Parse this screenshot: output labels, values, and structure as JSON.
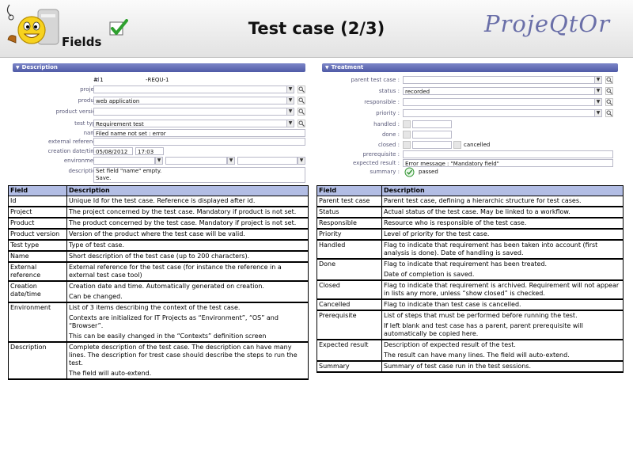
{
  "header": {
    "fields_label": "Fields",
    "title": "Test case (2/3)",
    "brand": "ProjeQtOr"
  },
  "description_panel": {
    "title": "Description",
    "fields": {
      "id": {
        "label": "id :",
        "value": "#  1",
        "ref": "-REQU-1"
      },
      "project": {
        "label": "project :",
        "value": ""
      },
      "product": {
        "label": "product :",
        "value": "web application"
      },
      "product_version": {
        "label": "product version :",
        "value": ""
      },
      "test_type": {
        "label": "test type :",
        "value": "Requirement test"
      },
      "name": {
        "label": "name :",
        "value": "Filed name not set : error"
      },
      "external_reference": {
        "label": "external reference :",
        "value": ""
      },
      "creation_datetime": {
        "label": "creation date/time :",
        "date": "05/08/2012",
        "time": "17:03"
      },
      "environment": {
        "label": "environment :"
      },
      "description": {
        "label": "description :",
        "line1": "Set field \"name\" empty.",
        "line2": "Save."
      }
    }
  },
  "treatment_panel": {
    "title": "Treatment",
    "fields": {
      "parent_test_case": {
        "label": "parent test case :",
        "value": ""
      },
      "status": {
        "label": "status :",
        "value": "recorded"
      },
      "responsible": {
        "label": "responsible :",
        "value": ""
      },
      "priority": {
        "label": "priority :",
        "value": ""
      },
      "handled": {
        "label": "handled :"
      },
      "done": {
        "label": "done :"
      },
      "closed": {
        "label": "closed :",
        "cancelled_label": "cancelled"
      },
      "prerequisite": {
        "label": "prerequisite :",
        "value": ""
      },
      "expected_result": {
        "label": "expected result :",
        "value": "Error message : \"Mandatory field\""
      },
      "summary": {
        "label": "summary :",
        "value": "passed"
      }
    }
  },
  "left_table": {
    "headers": [
      "Field",
      "Description"
    ],
    "rows": [
      {
        "field": "Id",
        "desc": [
          "Unique Id for the test case. Reference is displayed after id."
        ]
      },
      {
        "field": "Project",
        "desc": [
          "The project concerned by the test case. Mandatory if product is not set."
        ]
      },
      {
        "field": "Product",
        "desc": [
          "The product concerned by the test case. Mandatory if project is not set."
        ]
      },
      {
        "field": "Product version",
        "desc": [
          "Version of the product where the test case will be valid."
        ]
      },
      {
        "field": "Test type",
        "desc": [
          "Type of test case."
        ]
      },
      {
        "field": "Name",
        "desc": [
          "Short description of the test case (up to 200 characters)."
        ]
      },
      {
        "field": "External reference",
        "desc": [
          "External reference for the test case (for instance the reference in a external test case tool)"
        ]
      },
      {
        "field": "Creation date/time",
        "desc": [
          "Creation date and time. Automatically generated on creation.",
          "Can be changed."
        ]
      },
      {
        "field": "Environment",
        "desc": [
          "List of 3 items describing the context of the test case.",
          "Contexts are initialized for IT Projects as “Environment”, “OS” and “Browser”.",
          "This can be easily changed in the “Contexts” definition screen"
        ]
      },
      {
        "field": "Description",
        "desc": [
          "Complete description of the test case. The description can have many lines. The description for trest case should describe the steps to run the test.",
          "The field will auto-extend."
        ]
      }
    ]
  },
  "right_table": {
    "headers": [
      "Field",
      "Description"
    ],
    "rows": [
      {
        "field": "Parent test case",
        "desc": [
          "Parent test case, defining a hierarchic structure for test cases."
        ]
      },
      {
        "field": "Status",
        "desc": [
          "Actual status of the test case. May be linked to a workflow."
        ]
      },
      {
        "field": "Responsible",
        "desc": [
          "Resource who is responsible of the test case."
        ]
      },
      {
        "field": "Priority",
        "desc": [
          "Level of priority for the test case."
        ]
      },
      {
        "field": "Handled",
        "desc": [
          "Flag to indicate that requirement has been taken into account (first analysis is done). Date of handling is saved."
        ]
      },
      {
        "field": "Done",
        "desc": [
          "Flag to indicate that requirement has been treated.",
          "Date of completion is saved."
        ]
      },
      {
        "field": "Closed",
        "desc": [
          "Flag to indicate that requirement is archived. Requirement will not appear in lists any more, unless “show closed” is checked."
        ]
      },
      {
        "field": "Cancelled",
        "desc": [
          "Flag to indicate than test case is cancelled."
        ]
      },
      {
        "field": "Prerequisite",
        "desc": [
          "List of steps that must be performed before running the test.",
          "If left blank and test case has a parent, parent prerequisite will automatically be copied here."
        ]
      },
      {
        "field": "Expected result",
        "desc": [
          "Description of expected result of the test.",
          "The result can have many lines. The field will auto-extend."
        ]
      },
      {
        "field": "Summary",
        "desc": [
          "Summary of test case run in the test sessions."
        ]
      }
    ]
  }
}
